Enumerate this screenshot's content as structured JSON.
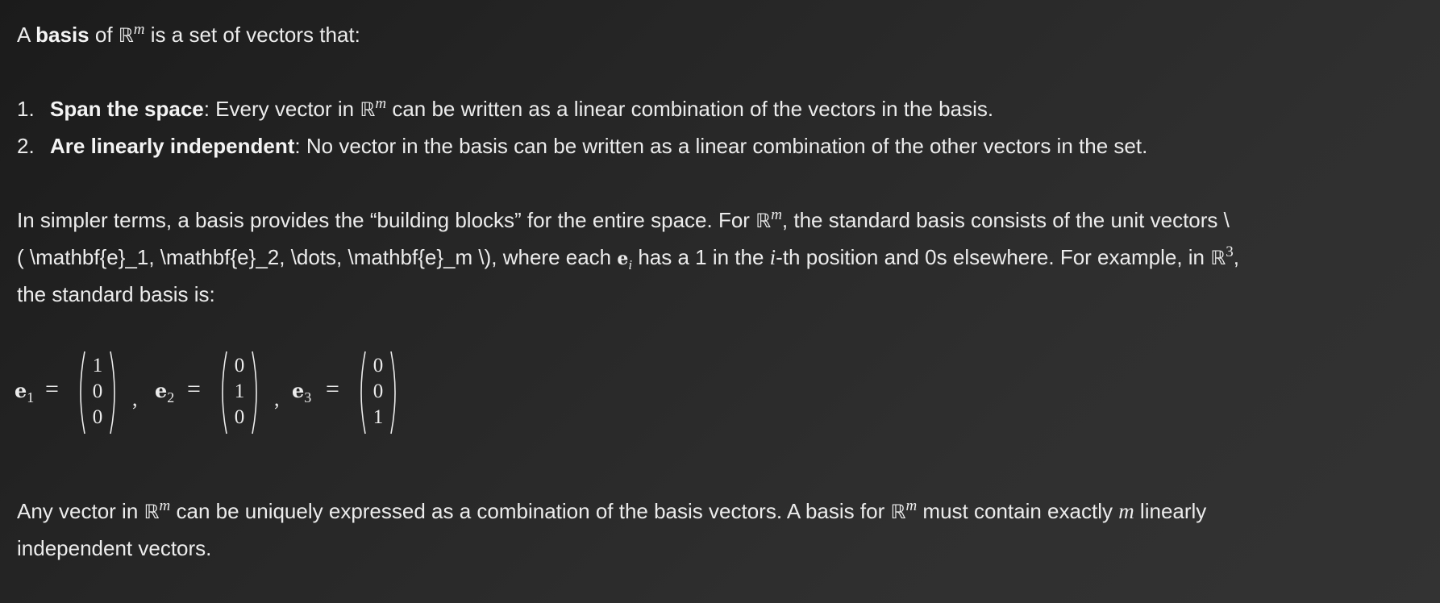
{
  "intro": {
    "t1": "A ",
    "basis": "basis",
    "t2": " of ",
    "R": "ℝ",
    "m": "m",
    "t3": " is a set of vectors that:"
  },
  "list": [
    {
      "num": "1.",
      "bold": "Span the space",
      "t1": ": Every vector in ",
      "R": "ℝ",
      "m": "m",
      "t2": " can be written as a linear combination of the vectors in the basis."
    },
    {
      "num": "2.",
      "bold": "Are linearly independent",
      "t1": ": No vector in the basis can be written as a linear combination of the other vectors in the set."
    }
  ],
  "simpler": {
    "line1_a": "In simpler terms, a basis provides the “building blocks” for the entire space. For ",
    "R": "ℝ",
    "m": "m",
    "line1_b": ", the standard basis consists of the unit vectors \\",
    "line2_a": "( \\mathbf{e}_1, \\mathbf{e}_2, \\dots, \\mathbf{e}_m \\), where each ",
    "e": "e",
    "i": "i",
    "line2_b": " has a 1 in the ",
    "line2_c": "-th position and 0s elsewhere. For example, in ",
    "three": "3",
    "line2_d": ",",
    "line3": "the standard basis is:"
  },
  "display": {
    "vectors": [
      {
        "label": "e",
        "sub": "1",
        "entries": [
          "1",
          "0",
          "0"
        ]
      },
      {
        "label": "e",
        "sub": "2",
        "entries": [
          "0",
          "1",
          "0"
        ]
      },
      {
        "label": "e",
        "sub": "3",
        "entries": [
          "0",
          "0",
          "1"
        ]
      }
    ],
    "equals": "=",
    "comma": ","
  },
  "final": {
    "t1": "Any vector in ",
    "R": "ℝ",
    "m": "m",
    "t2": " can be uniquely expressed as a combination of the basis vectors. A basis for ",
    "t3": " must contain exactly ",
    "t4": " linearly",
    "line2": "independent vectors."
  }
}
